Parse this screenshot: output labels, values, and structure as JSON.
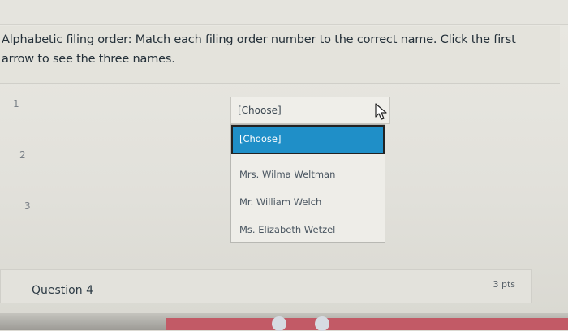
{
  "question": {
    "instruction": "Alphabetic filing order: Match each filing order number to the correct name. Click the first arrow to see the three names."
  },
  "rows": [
    {
      "number": "1"
    },
    {
      "number": "2"
    },
    {
      "number": "3"
    }
  ],
  "select": {
    "current_value": "[Choose]",
    "options": [
      "[Choose]",
      "Mrs. Wilma Weltman",
      "Mr. William Welch",
      "Ms. Elizabeth Wetzel"
    ],
    "highlighted_option": "[Choose]"
  },
  "next_question": {
    "title": "Question 4",
    "points": "3 pts"
  },
  "colors": {
    "selected_option_bg": "#1f8fc8",
    "text_primary": "#2d3b45"
  }
}
